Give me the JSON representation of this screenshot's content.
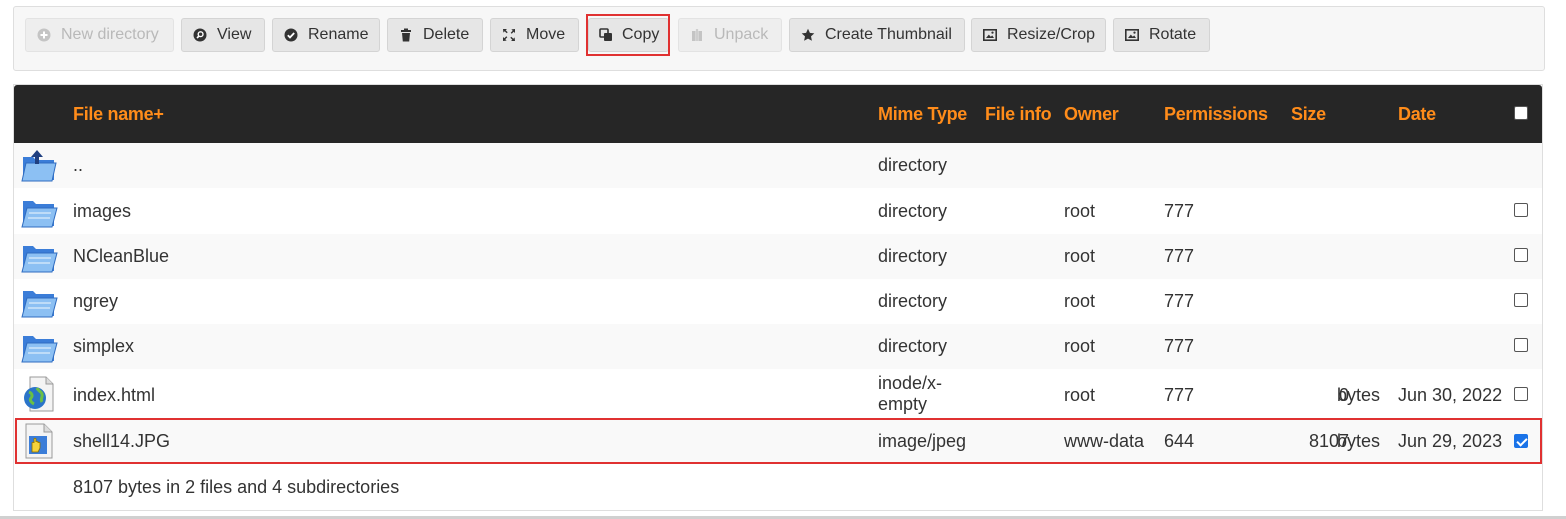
{
  "toolbar": {
    "buttons": [
      {
        "label": "New directory",
        "icon": "plus-circle-icon",
        "disabled": true
      },
      {
        "label": "View",
        "icon": "magnifier-icon",
        "disabled": false
      },
      {
        "label": "Rename",
        "icon": "check-circle-icon",
        "disabled": false
      },
      {
        "label": "Delete",
        "icon": "trash-icon",
        "disabled": false
      },
      {
        "label": "Move",
        "icon": "move-arrows-icon",
        "disabled": false
      },
      {
        "label": "Copy",
        "icon": "copy-icon",
        "disabled": false,
        "highlighted": true
      },
      {
        "label": "Unpack",
        "icon": "archive-icon",
        "disabled": true
      },
      {
        "label": "Create Thumbnail",
        "icon": "star-icon",
        "disabled": false
      },
      {
        "label": "Resize/Crop",
        "icon": "image-icon",
        "disabled": false
      },
      {
        "label": "Rotate",
        "icon": "image-icon",
        "disabled": false
      }
    ]
  },
  "table": {
    "headers": {
      "name": "File name+",
      "mime": "Mime Type",
      "info": "File info",
      "owner": "Owner",
      "permissions": "Permissions",
      "size": "Size",
      "date": "Date"
    },
    "rows": [
      {
        "icon": "parent-folder-icon",
        "name": "..",
        "mime": "directory",
        "owner": "",
        "permissions": "",
        "size": "",
        "unit": "",
        "date": "",
        "checkbox": false,
        "checked": false
      },
      {
        "icon": "folder-icon",
        "name": "images",
        "mime": "directory",
        "owner": "root",
        "permissions": "777",
        "size": "",
        "unit": "",
        "date": "",
        "checkbox": true,
        "checked": false
      },
      {
        "icon": "folder-icon",
        "name": "NCleanBlue",
        "mime": "directory",
        "owner": "root",
        "permissions": "777",
        "size": "",
        "unit": "",
        "date": "",
        "checkbox": true,
        "checked": false
      },
      {
        "icon": "folder-icon",
        "name": "ngrey",
        "mime": "directory",
        "owner": "root",
        "permissions": "777",
        "size": "",
        "unit": "",
        "date": "",
        "checkbox": true,
        "checked": false
      },
      {
        "icon": "folder-icon",
        "name": "simplex",
        "mime": "directory",
        "owner": "root",
        "permissions": "777",
        "size": "",
        "unit": "",
        "date": "",
        "checkbox": true,
        "checked": false
      },
      {
        "icon": "web-file-icon",
        "name": "index.html",
        "mime_line1": "inode/x-",
        "mime_line2": "empty",
        "owner": "root",
        "permissions": "777",
        "size": "0",
        "unit": "bytes",
        "date": "Jun 30, 2022",
        "checkbox": true,
        "checked": false
      },
      {
        "icon": "image-file-icon",
        "name": "shell14.JPG",
        "mime": "image/jpeg",
        "owner": "www-data",
        "permissions": "644",
        "size": "8107",
        "unit": "bytes",
        "date": "Jun 29, 2023",
        "checkbox": true,
        "checked": true,
        "highlighted": true
      }
    ],
    "footer": "8107 bytes in 2 files and 4 subdirectories"
  },
  "colors": {
    "header_bg": "#262626",
    "header_text": "#ff8c1a",
    "highlight": "#e03131",
    "checkbox_checked": "#1a73e8"
  }
}
